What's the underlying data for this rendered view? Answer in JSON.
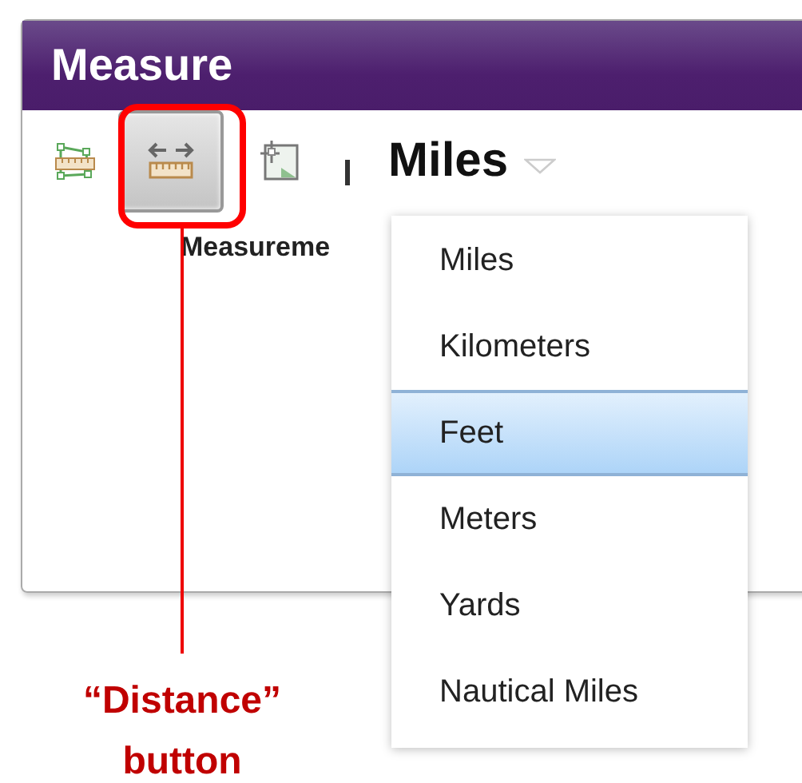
{
  "window": {
    "title": "Measure"
  },
  "toolbar": {
    "tools": [
      {
        "kind": "area",
        "selected": false
      },
      {
        "kind": "distance",
        "selected": true
      },
      {
        "kind": "location",
        "selected": false
      }
    ],
    "unit": "Miles"
  },
  "result_label": "Measureme",
  "unit_menu": {
    "items": [
      {
        "label": "Miles",
        "selected": false
      },
      {
        "label": "Kilometers",
        "selected": false
      },
      {
        "label": "Feet",
        "selected": true
      },
      {
        "label": "Meters",
        "selected": false
      },
      {
        "label": "Yards",
        "selected": false
      },
      {
        "label": "Nautical Miles",
        "selected": false
      }
    ]
  },
  "callout": {
    "text": "“Distance” button"
  }
}
